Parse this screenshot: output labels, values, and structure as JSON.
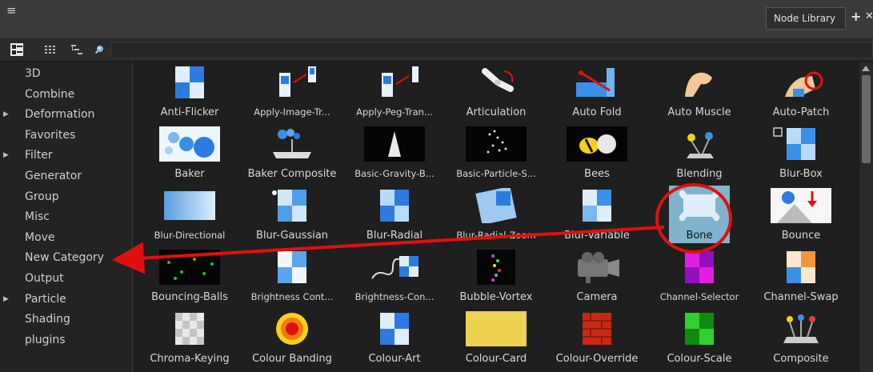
{
  "titlebar": {
    "menu_icon": "hamburger-menu-icon",
    "tab_label": "Node Library"
  },
  "toolbar": {
    "icons": [
      "list-view-icon",
      "grid-view-icon",
      "tree-view-icon",
      "search-icon"
    ],
    "filter_value": ""
  },
  "sidebar": {
    "items": [
      {
        "label": "3D",
        "expandable": false
      },
      {
        "label": "Combine",
        "expandable": false
      },
      {
        "label": "Deformation",
        "expandable": true
      },
      {
        "label": "Favorites",
        "expandable": false
      },
      {
        "label": "Filter",
        "expandable": true
      },
      {
        "label": "Generator",
        "expandable": false
      },
      {
        "label": "Group",
        "expandable": false
      },
      {
        "label": "Misc",
        "expandable": false
      },
      {
        "label": "Move",
        "expandable": false
      },
      {
        "label": "New Category",
        "expandable": false
      },
      {
        "label": "Output",
        "expandable": false
      },
      {
        "label": "Particle",
        "expandable": true
      },
      {
        "label": "Shading",
        "expandable": false
      },
      {
        "label": "plugins",
        "expandable": false
      }
    ]
  },
  "grid": {
    "rows": [
      [
        {
          "label": "Anti-Flicker",
          "icon": "anti-flicker-icon"
        },
        {
          "label": "Apply-Image-Tr...",
          "icon": "apply-image-transform-icon"
        },
        {
          "label": "Apply-Peg-Tran...",
          "icon": "apply-peg-transform-icon"
        },
        {
          "label": "Articulation",
          "icon": "articulation-icon"
        },
        {
          "label": "Auto Fold",
          "icon": "auto-fold-icon"
        },
        {
          "label": "Auto Muscle",
          "icon": "auto-muscle-icon"
        },
        {
          "label": "Auto-Patch",
          "icon": "auto-patch-icon"
        }
      ],
      [
        {
          "label": "Baker",
          "icon": "baker-icon"
        },
        {
          "label": "Baker Composite",
          "icon": "baker-composite-icon"
        },
        {
          "label": "Basic-Gravity-B...",
          "icon": "basic-gravity-icon"
        },
        {
          "label": "Basic-Particle-S...",
          "icon": "basic-particle-icon"
        },
        {
          "label": "Bees",
          "icon": "bees-icon"
        },
        {
          "label": "Blending",
          "icon": "blending-icon"
        },
        {
          "label": "Blur-Box",
          "icon": "blur-box-icon"
        }
      ],
      [
        {
          "label": "Blur-Directional",
          "icon": "blur-directional-icon"
        },
        {
          "label": "Blur-Gaussian",
          "icon": "blur-gaussian-icon"
        },
        {
          "label": "Blur-Radial",
          "icon": "blur-radial-icon"
        },
        {
          "label": "Blur-Radial-Zoom",
          "icon": "blur-radial-zoom-icon"
        },
        {
          "label": "Blur-Variable",
          "icon": "blur-variable-icon"
        },
        {
          "label": "Bone",
          "icon": "bone-icon",
          "selected": true
        },
        {
          "label": "Bounce",
          "icon": "bounce-icon"
        }
      ],
      [
        {
          "label": "Bouncing-Balls",
          "icon": "bouncing-balls-icon"
        },
        {
          "label": "Brightness Cont...",
          "icon": "brightness-contrast-icon"
        },
        {
          "label": "Brightness-Con...",
          "icon": "brightness-contrast-2-icon"
        },
        {
          "label": "Bubble-Vortex",
          "icon": "bubble-vortex-icon"
        },
        {
          "label": "Camera",
          "icon": "camera-icon"
        },
        {
          "label": "Channel-Selector",
          "icon": "channel-selector-icon"
        },
        {
          "label": "Channel-Swap",
          "icon": "channel-swap-icon"
        }
      ],
      [
        {
          "label": "Chroma-Keying",
          "icon": "chroma-keying-icon"
        },
        {
          "label": "Colour Banding",
          "icon": "colour-banding-icon"
        },
        {
          "label": "Colour-Art",
          "icon": "colour-art-icon"
        },
        {
          "label": "Colour-Card",
          "icon": "colour-card-icon"
        },
        {
          "label": "Colour-Override",
          "icon": "colour-override-icon"
        },
        {
          "label": "Colour-Scale",
          "icon": "colour-scale-icon"
        },
        {
          "label": "Composite",
          "icon": "composite-icon"
        }
      ]
    ]
  },
  "annotation": {
    "highlight_color": "#e01010",
    "target_category": "New Category",
    "source_node": "Bone"
  },
  "colors": {
    "selection": "#7fb4cc",
    "panel_bg": "#1f1f1f",
    "sidebar_bg": "#232323"
  }
}
